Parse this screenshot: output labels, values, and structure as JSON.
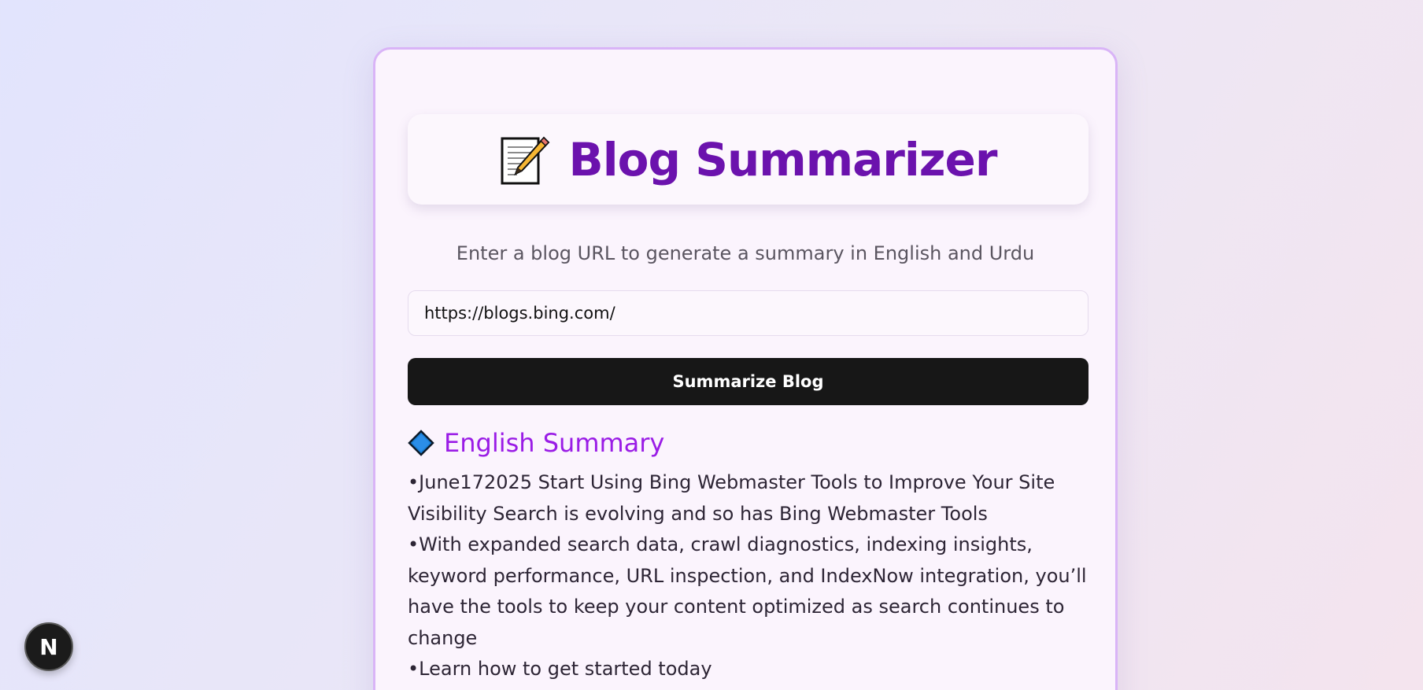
{
  "app": {
    "title": "Blog Summarizer",
    "title_icon": "memo-icon",
    "subtitle": "Enter a blog URL to generate a summary in English and Urdu"
  },
  "form": {
    "url_value": "https://blogs.bing.com/",
    "submit_label": "Summarize Blog"
  },
  "summary": {
    "heading": "English Summary",
    "heading_icon": "blue-diamond-icon",
    "items": [
      "June172025 Start Using Bing Webmaster Tools to Improve Your Site Visibility Search is evolving and so has Bing Webmaster Tools",
      "With expanded search data, crawl diagnostics, indexing insights, keyword performance, URL inspection, and IndexNow integration, you’ll have the tools to keep your content optimized as search continues to change",
      "Learn how to get started today"
    ]
  },
  "dev_badge": {
    "label": "N",
    "icon": "nextjs-icon"
  },
  "colors": {
    "title": "#6b12ad",
    "section_heading": "#9a1ce6",
    "button_bg": "#171717",
    "card_border": "#d9b4f7"
  }
}
